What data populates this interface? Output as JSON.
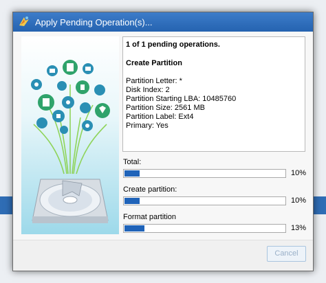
{
  "window": {
    "title": "Apply Pending Operation(s)..."
  },
  "details": {
    "pending_summary": "1 of 1 pending operations.",
    "operation_title": "Create Partition",
    "lines": [
      "Partition Letter: *",
      "Disk Index: 2",
      "Partition Starting LBA: 10485760",
      "Partition Size: 2561 MB",
      "Partition Label: Ext4",
      "Primary: Yes"
    ]
  },
  "progress": [
    {
      "label": "Total:",
      "percent_text": "10%",
      "value": 0.1
    },
    {
      "label": "Create partition:",
      "percent_text": "10%",
      "value": 0.1
    },
    {
      "label": "Format partition",
      "percent_text": "13%",
      "value": 0.13
    }
  ],
  "buttons": {
    "cancel_label": "Cancel"
  },
  "colors": {
    "titlebar": "#2c6bba",
    "progress_fill": "#1f63b9",
    "art_bg": "#9dd9ea"
  }
}
